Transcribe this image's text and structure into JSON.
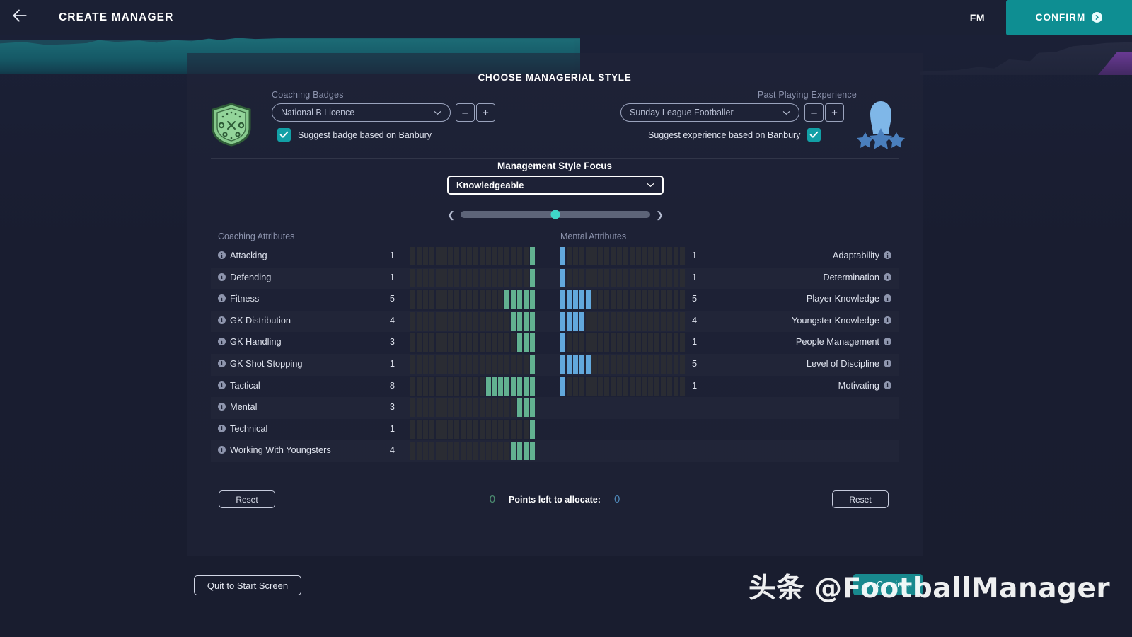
{
  "topbar": {
    "back_icon": "arrow-left-icon",
    "title": "CREATE MANAGER",
    "fm_logo": "FM",
    "confirm_label": "CONFIRM"
  },
  "card": {
    "title": "CHOOSE MANAGERIAL STYLE"
  },
  "badges": {
    "coaching_label": "Coaching Badges",
    "coaching_value": "National B Licence",
    "coaching_minus": "–",
    "coaching_plus": "+",
    "coaching_check_label": "Suggest badge based on Banbury",
    "coaching_checked": true,
    "experience_label": "Past Playing Experience",
    "experience_value": "Sunday League Footballer",
    "experience_minus": "–",
    "experience_plus": "+",
    "experience_check_label": "Suggest experience based on Banbury",
    "experience_checked": true
  },
  "focus": {
    "title": "Management Style Focus",
    "value": "Knowledgeable",
    "slider_left_icon": "chevron-left-icon",
    "slider_right_icon": "chevron-right-icon",
    "slider_percent": 50
  },
  "attributes": {
    "left_header": "Coaching Attributes",
    "right_header": "Mental Attributes",
    "max": 20,
    "left": [
      {
        "label": "Attacking",
        "value": 1
      },
      {
        "label": "Defending",
        "value": 1
      },
      {
        "label": "Fitness",
        "value": 5
      },
      {
        "label": "GK Distribution",
        "value": 4
      },
      {
        "label": "GK Handling",
        "value": 3
      },
      {
        "label": "GK Shot Stopping",
        "value": 1
      },
      {
        "label": "Tactical",
        "value": 8
      },
      {
        "label": "Mental",
        "value": 3
      },
      {
        "label": "Technical",
        "value": 1
      },
      {
        "label": "Working With Youngsters",
        "value": 4
      }
    ],
    "right": [
      {
        "label": "Adaptability",
        "value": 1
      },
      {
        "label": "Determination",
        "value": 1
      },
      {
        "label": "Player Knowledge",
        "value": 5
      },
      {
        "label": "Youngster Knowledge",
        "value": 4
      },
      {
        "label": "People Management",
        "value": 1
      },
      {
        "label": "Level of Discipline",
        "value": 5
      },
      {
        "label": "Motivating",
        "value": 1
      }
    ],
    "colors": {
      "coaching_bar": "#62b190",
      "mental_bar": "#62a8dc",
      "empty_bar": "#2a2c33"
    }
  },
  "footer": {
    "reset_left_label": "Reset",
    "reset_right_label": "Reset",
    "points_left_value": "0",
    "points_label": "Points left to allocate:",
    "points_right_value": "0",
    "quit_label": "Quit to Start Screen",
    "continue_label": "Continue"
  },
  "watermark": {
    "text": "头条 @FootballManager"
  }
}
